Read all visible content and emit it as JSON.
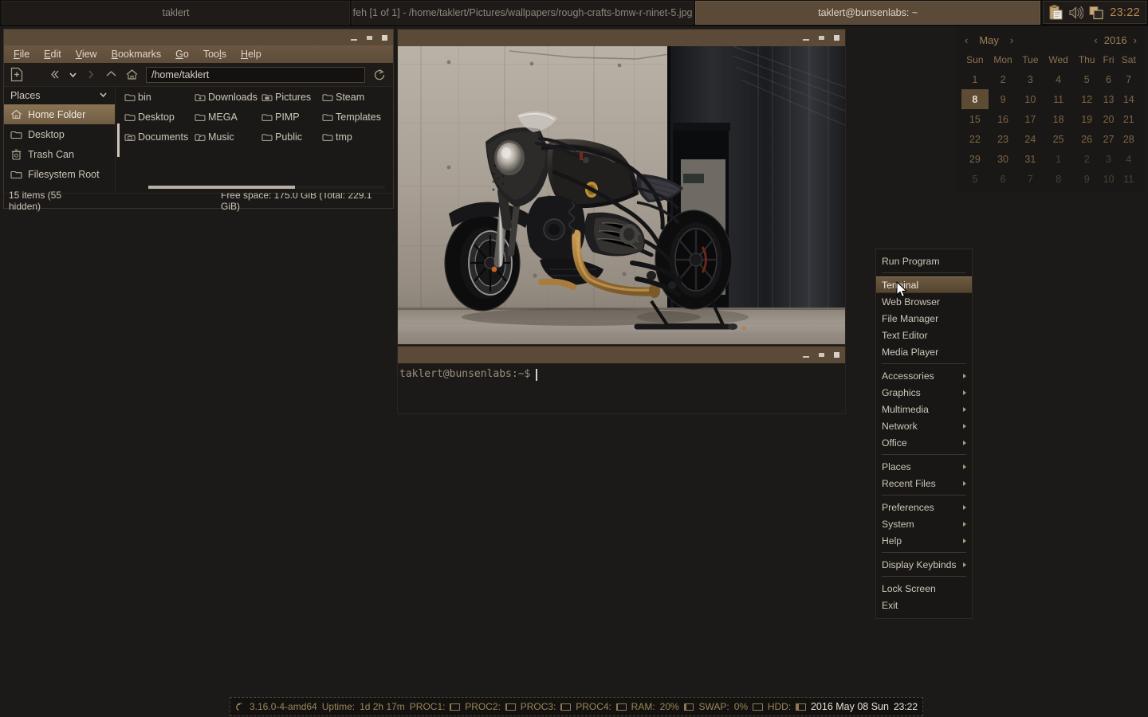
{
  "taskbar": {
    "tasks": [
      {
        "label": "taklert",
        "active": false
      },
      {
        "label": "feh [1 of 1] - /home/taklert/Pictures/wallpapers/rough-crafts-bmw-r-ninet-5.jpg",
        "active": false
      },
      {
        "label": "taklert@bunsenlabs: ~",
        "active": true
      }
    ],
    "tray": {
      "clipboard_icon": "clipboard-icon",
      "volume_icon": "speaker-icon",
      "workspace_icon": "workspaces-icon"
    },
    "clock": "23:22"
  },
  "file_manager": {
    "menus": [
      "File",
      "Edit",
      "View",
      "Bookmarks",
      "Go",
      "Tools",
      "Help"
    ],
    "toolbar": {
      "new_tab": "new-tab-icon",
      "back": "back-icon",
      "history": "history-dropdown-icon",
      "forward": "forward-icon",
      "up": "up-icon",
      "home": "home-icon",
      "reload": "reload-icon"
    },
    "path_value": "/home/taklert",
    "sidebar": {
      "header": "Places",
      "items": [
        {
          "label": "Home Folder",
          "icon": "home-icon",
          "selected": true
        },
        {
          "label": "Desktop",
          "icon": "folder-icon",
          "selected": false
        },
        {
          "label": "Trash Can",
          "icon": "trash-icon",
          "selected": false
        },
        {
          "label": "Filesystem Root",
          "icon": "folder-icon",
          "selected": false
        }
      ]
    },
    "files": [
      {
        "label": "bin",
        "icon": "folder-icon"
      },
      {
        "label": "Downloads",
        "icon": "folder-download-icon"
      },
      {
        "label": "Pictures",
        "icon": "folder-pictures-icon"
      },
      {
        "label": "Steam",
        "icon": "folder-icon"
      },
      {
        "label": "Desktop",
        "icon": "folder-icon"
      },
      {
        "label": "MEGA",
        "icon": "folder-icon"
      },
      {
        "label": "PIMP",
        "icon": "folder-icon"
      },
      {
        "label": "Templates",
        "icon": "folder-icon"
      },
      {
        "label": "Documents",
        "icon": "folder-documents-icon"
      },
      {
        "label": "Music",
        "icon": "folder-music-icon"
      },
      {
        "label": "Public",
        "icon": "folder-icon"
      },
      {
        "label": "tmp",
        "icon": "folder-icon"
      }
    ],
    "status_items": "15 items (55 hidden)",
    "status_free": "Free space: 175.0 GiB (Total: 229.1 GiB)"
  },
  "terminal": {
    "prompt": "taklert@bunsenlabs:~$"
  },
  "root_menu": {
    "items": [
      {
        "label": "Run Program",
        "submenu": false,
        "highlighted": false
      },
      {
        "sep": true
      },
      {
        "label": "Terminal",
        "submenu": false,
        "highlighted": true
      },
      {
        "label": "Web Browser",
        "submenu": false,
        "highlighted": false
      },
      {
        "label": "File Manager",
        "submenu": false,
        "highlighted": false
      },
      {
        "label": "Text Editor",
        "submenu": false,
        "highlighted": false
      },
      {
        "label": "Media Player",
        "submenu": false,
        "highlighted": false
      },
      {
        "sep": true
      },
      {
        "label": "Accessories",
        "submenu": true,
        "highlighted": false
      },
      {
        "label": "Graphics",
        "submenu": true,
        "highlighted": false
      },
      {
        "label": "Multimedia",
        "submenu": true,
        "highlighted": false
      },
      {
        "label": "Network",
        "submenu": true,
        "highlighted": false
      },
      {
        "label": "Office",
        "submenu": true,
        "highlighted": false
      },
      {
        "sep": true
      },
      {
        "label": "Places",
        "submenu": true,
        "highlighted": false
      },
      {
        "label": "Recent Files",
        "submenu": true,
        "highlighted": false
      },
      {
        "sep": true
      },
      {
        "label": "Preferences",
        "submenu": true,
        "highlighted": false
      },
      {
        "label": "System",
        "submenu": true,
        "highlighted": false
      },
      {
        "label": "Help",
        "submenu": true,
        "highlighted": false
      },
      {
        "sep": true
      },
      {
        "label": "Display Keybinds",
        "submenu": true,
        "highlighted": false
      },
      {
        "sep": true
      },
      {
        "label": "Lock Screen",
        "submenu": false,
        "highlighted": false
      },
      {
        "label": "Exit",
        "submenu": false,
        "highlighted": false
      }
    ]
  },
  "calendar": {
    "month": "May",
    "year": "2016",
    "weekdays": [
      "Sun",
      "Mon",
      "Tue",
      "Wed",
      "Thu",
      "Fri",
      "Sat"
    ],
    "weeks": [
      [
        {
          "d": "1"
        },
        {
          "d": "2"
        },
        {
          "d": "3"
        },
        {
          "d": "4"
        },
        {
          "d": "5"
        },
        {
          "d": "6"
        },
        {
          "d": "7"
        }
      ],
      [
        {
          "d": "8",
          "today": true
        },
        {
          "d": "9"
        },
        {
          "d": "10"
        },
        {
          "d": "11"
        },
        {
          "d": "12"
        },
        {
          "d": "13"
        },
        {
          "d": "14"
        }
      ],
      [
        {
          "d": "15"
        },
        {
          "d": "16"
        },
        {
          "d": "17"
        },
        {
          "d": "18"
        },
        {
          "d": "19"
        },
        {
          "d": "20"
        },
        {
          "d": "21"
        }
      ],
      [
        {
          "d": "22"
        },
        {
          "d": "23"
        },
        {
          "d": "24"
        },
        {
          "d": "25"
        },
        {
          "d": "26"
        },
        {
          "d": "27"
        },
        {
          "d": "28"
        }
      ],
      [
        {
          "d": "29"
        },
        {
          "d": "30"
        },
        {
          "d": "31"
        },
        {
          "d": "1",
          "dim": true
        },
        {
          "d": "2",
          "dim": true
        },
        {
          "d": "3",
          "dim": true
        },
        {
          "d": "4",
          "dim": true
        }
      ],
      [
        {
          "d": "5",
          "dim": true
        },
        {
          "d": "6",
          "dim": true
        },
        {
          "d": "7",
          "dim": true
        },
        {
          "d": "8",
          "dim": true
        },
        {
          "d": "9",
          "dim": true
        },
        {
          "d": "10",
          "dim": true
        },
        {
          "d": "11",
          "dim": true
        }
      ]
    ]
  },
  "conky": {
    "kernel": "3.16.0-4-amd64",
    "uptime_label": "Uptime:",
    "uptime_value": "1d 2h 17m",
    "procs": [
      {
        "label": "PROC1:",
        "pct": 4
      },
      {
        "label": "PROC2:",
        "pct": 4
      },
      {
        "label": "PROC3:",
        "pct": 4
      },
      {
        "label": "PROC4:",
        "pct": 4
      }
    ],
    "ram_label": "RAM:",
    "ram_value": "20%",
    "ram_pct": 20,
    "swap_label": "SWAP:",
    "swap_value": "0%",
    "swap_pct": 0,
    "hdd_label": "HDD:",
    "hdd_pct": 24,
    "date": "2016 May 08 Sun",
    "time": "23:22"
  },
  "colors": {
    "accent": "#5a4a37",
    "highlight": "#6c5942",
    "desktop_bg": "#1c1a19",
    "panel_bg": "#100f0e",
    "text": "#cdc5b9",
    "calendar_text": "#7d6445"
  }
}
